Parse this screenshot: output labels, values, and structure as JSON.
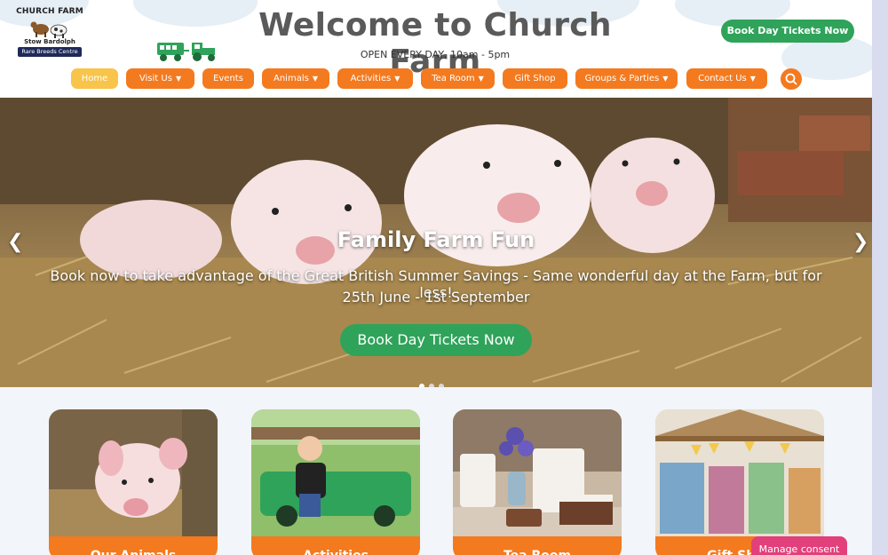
{
  "logo": {
    "title": "CHURCH FARM",
    "subtitle": "Stow Bardolph",
    "badge": "Rare Breeds Centre"
  },
  "header": {
    "title": "Welcome to Church Farm",
    "opening_hours": "OPEN EVERY DAY, 10am - 5pm",
    "cta_label": "Book Day Tickets Now"
  },
  "nav": {
    "items": [
      {
        "label": "Home",
        "dropdown": false
      },
      {
        "label": "Visit Us",
        "dropdown": true
      },
      {
        "label": "Events",
        "dropdown": false
      },
      {
        "label": "Animals",
        "dropdown": true
      },
      {
        "label": "Activities",
        "dropdown": true
      },
      {
        "label": "Tea Room",
        "dropdown": true
      },
      {
        "label": "Gift Shop",
        "dropdown": false
      },
      {
        "label": "Groups & Parties",
        "dropdown": true
      },
      {
        "label": "Contact Us",
        "dropdown": true
      }
    ],
    "search_icon": "search-icon"
  },
  "hero": {
    "title": "Family Farm Fun",
    "text": "Book now to take advantage of the Great British Summer Savings - Same wonderful day at the Farm, but for less!",
    "date_range": "25th June - 1st September",
    "cta_label": "Book Day Tickets Now",
    "prev_icon": "chevron-left-icon",
    "next_icon": "chevron-right-icon",
    "slide_count": 3,
    "active_slide": 1
  },
  "cards": [
    {
      "label": "Our Animals"
    },
    {
      "label": "Activities"
    },
    {
      "label": "Tea Room"
    },
    {
      "label": "Gift Shop"
    }
  ],
  "consent": {
    "label": "Manage consent"
  },
  "colors": {
    "accent_orange": "#f47a1f",
    "active_yellow": "#f8c44a",
    "cta_green": "#2fa35a",
    "consent_pink": "#e2407a",
    "title_grey": "#5a5a5a"
  }
}
